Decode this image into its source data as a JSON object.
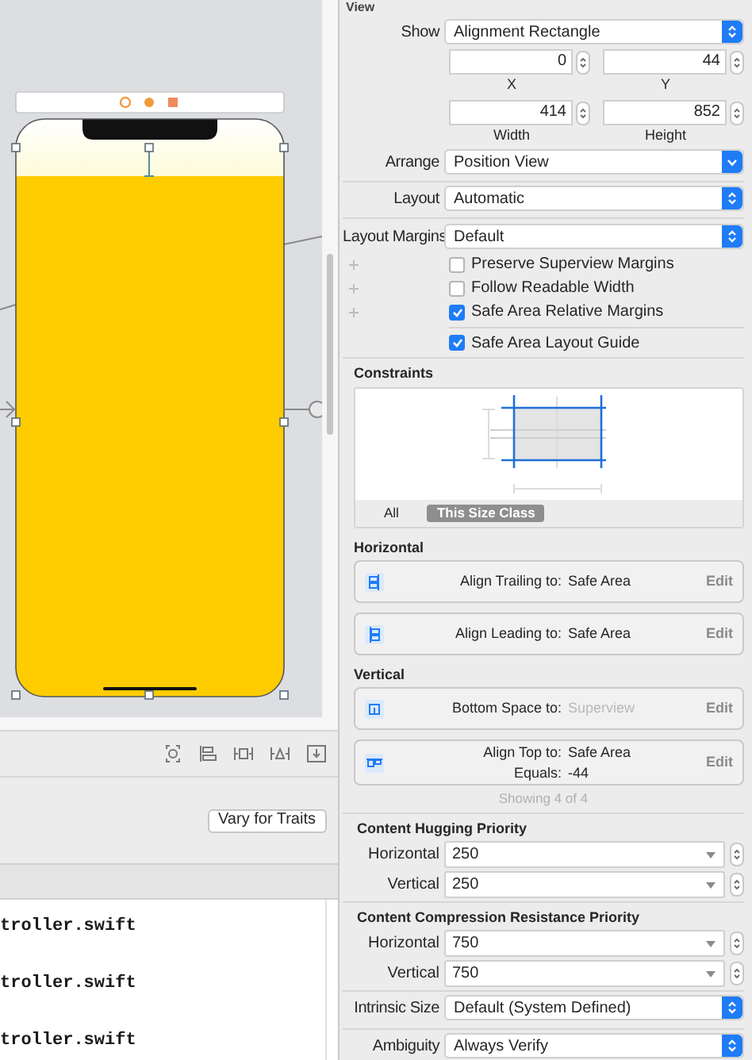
{
  "editor_bar": {
    "vary_button": "Vary for Traits"
  },
  "code_lines": [
    "troller.swift",
    "troller.swift",
    "troller.swift"
  ],
  "inspector": {
    "section_title": "View",
    "show": {
      "label": "Show",
      "value": "Alignment Rectangle",
      "kind": "popup"
    },
    "frame_fields": [
      {
        "value": "0",
        "label": "X"
      },
      {
        "value": "44",
        "label": "Y"
      },
      {
        "value": "414",
        "label": "Width"
      },
      {
        "value": "852",
        "label": "Height"
      }
    ],
    "arrange": {
      "label": "Arrange",
      "value": "Position View",
      "kind": "pulldown"
    },
    "layout": {
      "label": "Layout",
      "value": "Automatic",
      "kind": "popup"
    },
    "layout_margins": {
      "label": "Layout Margins",
      "value": "Default",
      "kind": "popup"
    },
    "margin_options": [
      {
        "label": "Preserve Superview Margins",
        "checked": false
      },
      {
        "label": "Follow Readable Width",
        "checked": false
      },
      {
        "label": "Safe Area Relative Margins",
        "checked": true
      }
    ],
    "safe_area_layout_guide": {
      "label": "Safe Area Layout Guide",
      "checked": true
    },
    "constraints": {
      "title": "Constraints",
      "filters": [
        {
          "label": "All",
          "selected": false
        },
        {
          "label": "This Size Class",
          "selected": true
        }
      ],
      "groups": [
        {
          "title": "Horizontal",
          "items": [
            {
              "kind": "trailing",
              "lines": [
                {
                  "label": "Align Trailing to:",
                  "value": "Safe Area"
                }
              ],
              "value_dimmed": false,
              "edit": "Edit"
            },
            {
              "kind": "leading",
              "lines": [
                {
                  "label": "Align Leading to:",
                  "value": "Safe Area"
                }
              ],
              "value_dimmed": false,
              "edit": "Edit"
            }
          ]
        },
        {
          "title": "Vertical",
          "items": [
            {
              "kind": "bottom",
              "lines": [
                {
                  "label": "Bottom Space to:",
                  "value": "Superview"
                }
              ],
              "value_dimmed": true,
              "edit": "Edit"
            },
            {
              "kind": "top",
              "lines": [
                {
                  "label": "Align Top to:",
                  "value": "Safe Area"
                },
                {
                  "label": "Equals:",
                  "value": "-44"
                }
              ],
              "value_dimmed": false,
              "edit": "Edit"
            }
          ]
        }
      ],
      "footer": "Showing 4 of 4"
    },
    "content_hugging": {
      "title": "Content Hugging Priority",
      "rows": [
        {
          "label": "Horizontal",
          "value": "250"
        },
        {
          "label": "Vertical",
          "value": "250"
        }
      ]
    },
    "compression_resistance": {
      "title": "Content Compression Resistance Priority",
      "rows": [
        {
          "label": "Horizontal",
          "value": "750"
        },
        {
          "label": "Vertical",
          "value": "750"
        }
      ]
    },
    "intrinsic_size": {
      "label": "Intrinsic Size",
      "value": "Default (System Defined)",
      "kind": "popup"
    },
    "ambiguity": {
      "label": "Ambiguity",
      "value": "Always Verify",
      "kind": "popup"
    }
  }
}
